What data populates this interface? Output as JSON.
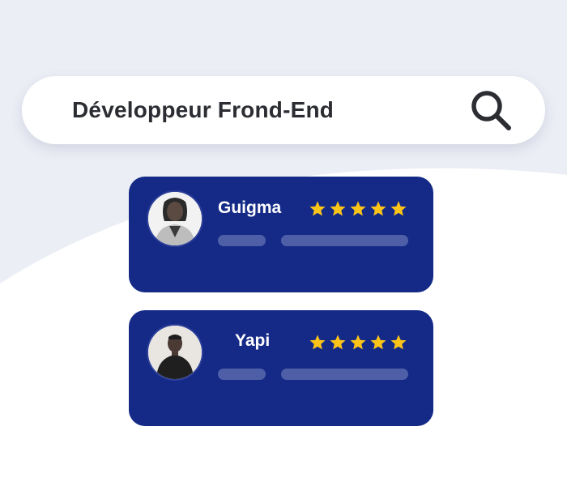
{
  "search": {
    "query": "Développeur Frond-End",
    "icon": "search-icon"
  },
  "colors": {
    "background_top": "#eceef6",
    "background_bottom": "#ffffff",
    "card": "#142a86",
    "placeholder_bar": "#4e5fa8",
    "star": "#fcc419",
    "text_dark": "#2b2d33"
  },
  "results": [
    {
      "name": "Guigma",
      "rating": 5,
      "rating_max": 5,
      "avatar": "woman-portrait"
    },
    {
      "name": "Yapi",
      "rating": 5,
      "rating_max": 5,
      "avatar": "man-portrait"
    }
  ]
}
